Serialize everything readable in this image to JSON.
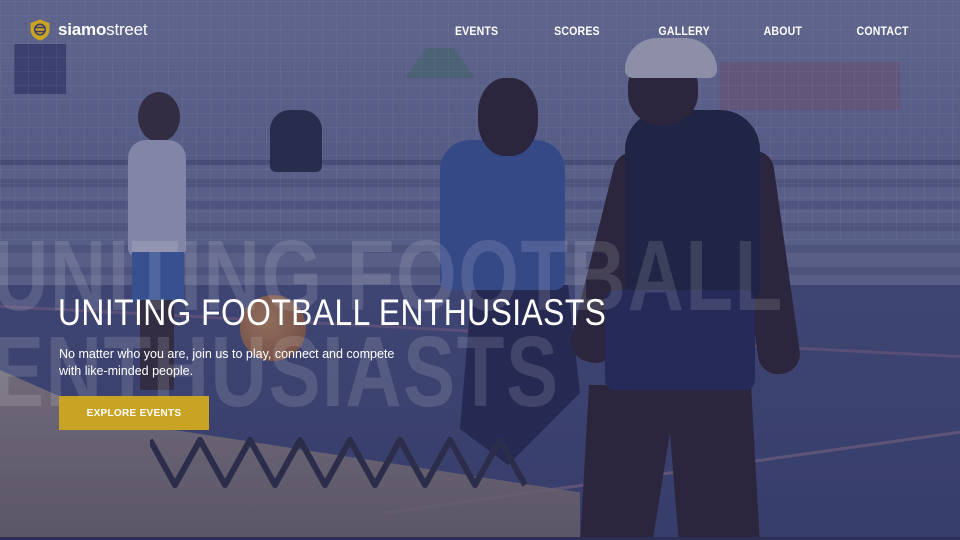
{
  "brand": {
    "name_bold": "siamo",
    "name_light": "street",
    "logo_icon": "shield-ball-icon",
    "accent_color": "#c9a324"
  },
  "nav": {
    "items": [
      {
        "label": "EVENTS"
      },
      {
        "label": "SCORES"
      },
      {
        "label": "GALLERY"
      },
      {
        "label": "ABOUT"
      },
      {
        "label": "CONTACT"
      }
    ]
  },
  "hero": {
    "watermark_line1": "UNITING FOOTBALL",
    "watermark_line2": "ENTHUSIASTS",
    "headline": "UNITING FOOTBALL ENTHUSIASTS",
    "subtext": "No matter who you are, join us to play, connect and compete with like-minded people.",
    "cta_label": "EXPLORE EVENTS",
    "overlay_color": "#2c3060"
  }
}
